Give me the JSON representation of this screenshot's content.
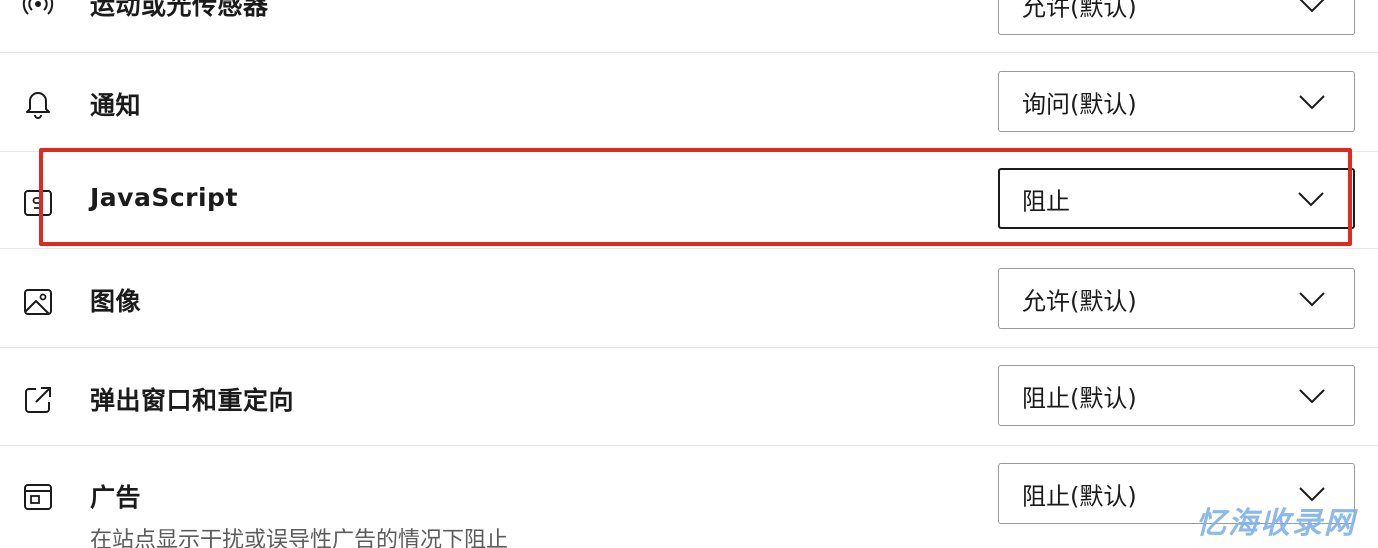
{
  "colors": {
    "highlight": "#e02a1f",
    "divider": "#e6e6e6",
    "select_border": "#9a9a9a",
    "watermark": "#7fb2ea"
  },
  "permissions": [
    {
      "icon": "motion-sensor-icon",
      "label": "运动或光传感器",
      "value": "允许(默认)"
    },
    {
      "icon": "bell-icon",
      "label": "通知",
      "value": "询问(默认)"
    },
    {
      "icon": "javascript-icon",
      "label": "JavaScript",
      "value": "阻止"
    },
    {
      "icon": "image-icon",
      "label": "图像",
      "value": "允许(默认)"
    },
    {
      "icon": "popup-redirect-icon",
      "label": "弹出窗口和重定向",
      "value": "阻止(默认)"
    },
    {
      "icon": "ads-icon",
      "label": "广告",
      "value": "阻止(默认)",
      "description": "在站点显示干扰或误导性广告的情况下阻止"
    }
  ],
  "watermark": "忆海收录网"
}
